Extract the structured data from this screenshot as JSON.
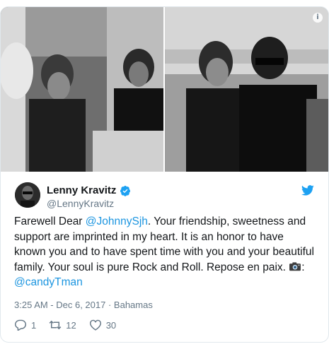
{
  "tweet": {
    "display_name": "Lenny Kravitz",
    "handle": "@LennyKravitz",
    "text_before_mention": "Farewell Dear ",
    "mention_1": "@JohnnySjh",
    "text_main": ". Your friendship, sweetness and support are imprinted in my heart. It is an honor to have known you and to have spent time with you and your beautiful family. Your soul is pure Rock and Roll. Repose en paix. ",
    "after_camera": ": ",
    "mention_2": "@candyTman",
    "time": "3:25 AM - Dec 6, 2017",
    "separator": " · ",
    "location": "Bahamas"
  },
  "actions": {
    "replies": "1",
    "retweets": "12",
    "likes": "30"
  },
  "info_glyph": "i",
  "icons": [
    "info-icon",
    "verified-icon",
    "twitter-bird-icon",
    "camera-icon",
    "reply-icon",
    "retweet-icon",
    "like-icon"
  ],
  "colors": {
    "link": "#1b95e0",
    "muted": "#657786",
    "verified": "#1da1f2",
    "border": "#e1e8ed"
  }
}
